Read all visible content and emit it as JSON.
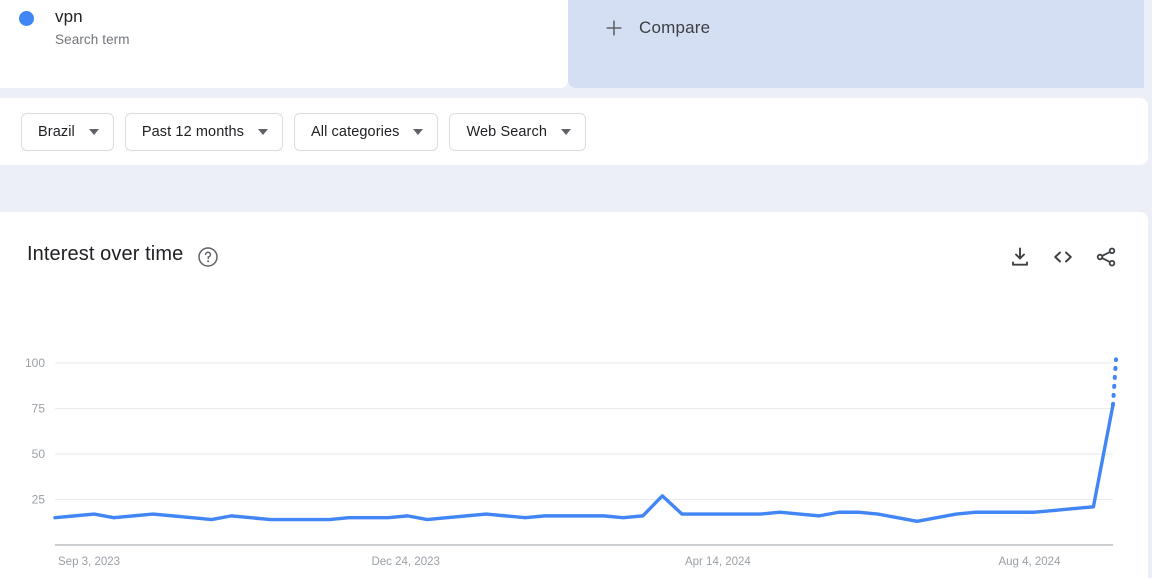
{
  "term_card": {
    "title": "vpn",
    "subtitle": "Search term",
    "dot_color": "#4285f4"
  },
  "compare_card": {
    "label": "Compare",
    "plus_icon": "plus-icon",
    "background": "#d5dff3"
  },
  "filters": [
    {
      "label": "Brazil"
    },
    {
      "label": "Past 12 months"
    },
    {
      "label": "All categories"
    },
    {
      "label": "Web Search"
    }
  ],
  "chart_header": {
    "title": "Interest over time",
    "help_icon": "help-circle-icon",
    "actions": [
      {
        "name": "download-icon"
      },
      {
        "name": "embed-code-icon"
      },
      {
        "name": "share-icon"
      }
    ]
  },
  "chart_data": {
    "type": "line",
    "title": "Interest over time",
    "xlabel": "",
    "ylabel": "",
    "ylim": [
      0,
      100
    ],
    "yticks": [
      25,
      50,
      75,
      100
    ],
    "grid": true,
    "legend": false,
    "line_color": "#4285f4",
    "xticks": [
      "Sep 3, 2023",
      "Dec 24, 2023",
      "Apr 14, 2024",
      "Aug 4, 2024"
    ],
    "xtick_positions": [
      0,
      16,
      32,
      48
    ],
    "series": [
      {
        "name": "vpn",
        "color": "#4285f4",
        "values": [
          15,
          16,
          17,
          15,
          16,
          17,
          16,
          15,
          14,
          16,
          15,
          14,
          14,
          14,
          14,
          15,
          15,
          15,
          16,
          14,
          15,
          16,
          17,
          16,
          15,
          16,
          16,
          16,
          16,
          15,
          16,
          27,
          17,
          17,
          17,
          17,
          17,
          18,
          17,
          16,
          18,
          18,
          17,
          15,
          13,
          15,
          17,
          18,
          18,
          18,
          18,
          19,
          20,
          21,
          77
        ],
        "partial_tail": [
          77,
          102
        ]
      }
    ]
  }
}
